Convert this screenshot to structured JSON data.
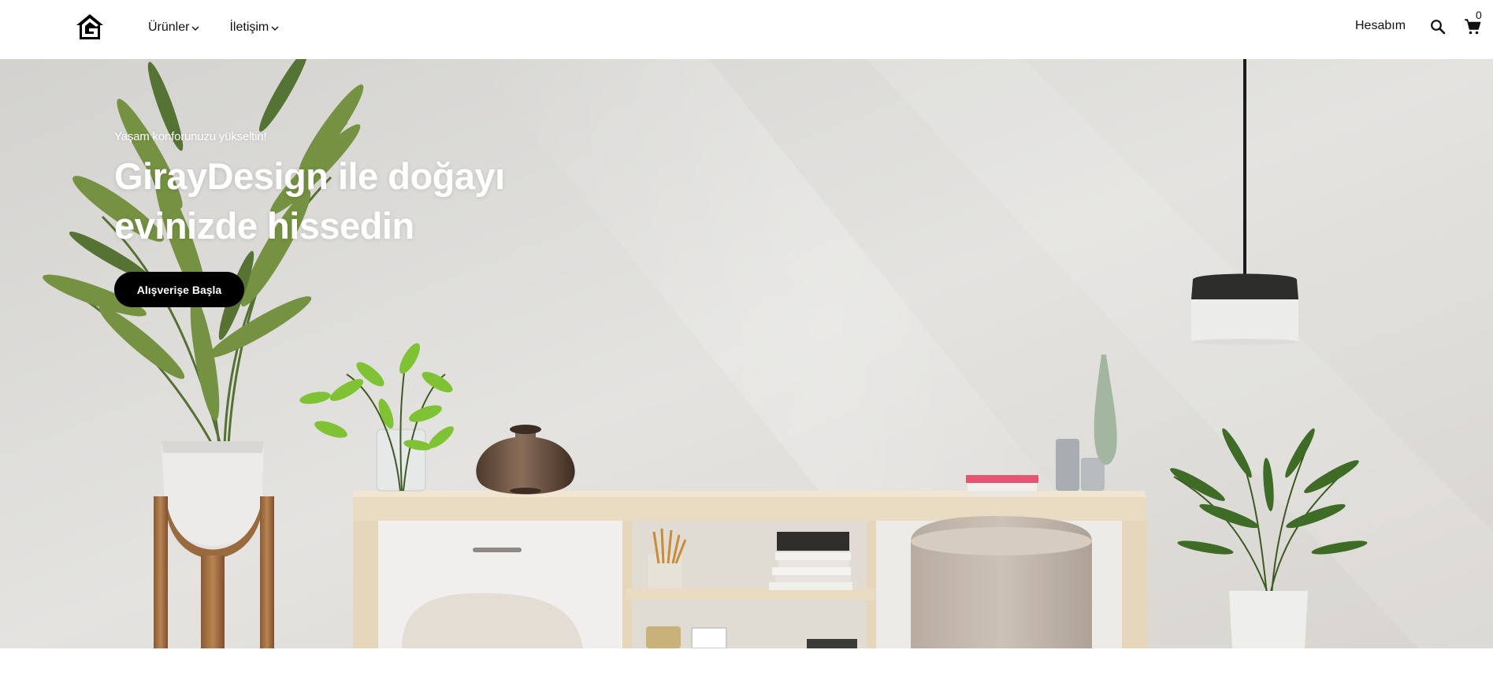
{
  "header": {
    "nav": [
      {
        "label": "Ürünler"
      },
      {
        "label": "İletişim"
      }
    ],
    "account_label": "Hesabım",
    "cart_count": "0"
  },
  "hero": {
    "subtitle": "Yaşam konforunuzu yükseltin!",
    "title_line1": "GirayDesign ile doğayı",
    "title_line2": "evinizde hissedin",
    "cta_label": "Alışverişe Başla"
  },
  "icons": {
    "logo": "g-house-logo",
    "chevron": "chevron-down-icon",
    "search": "search-icon",
    "cart": "cart-icon"
  },
  "colors": {
    "text": "#111111",
    "cta_bg": "#000000",
    "cta_text": "#ffffff",
    "hero_text": "#ffffff",
    "wall": "#dedcd8"
  }
}
